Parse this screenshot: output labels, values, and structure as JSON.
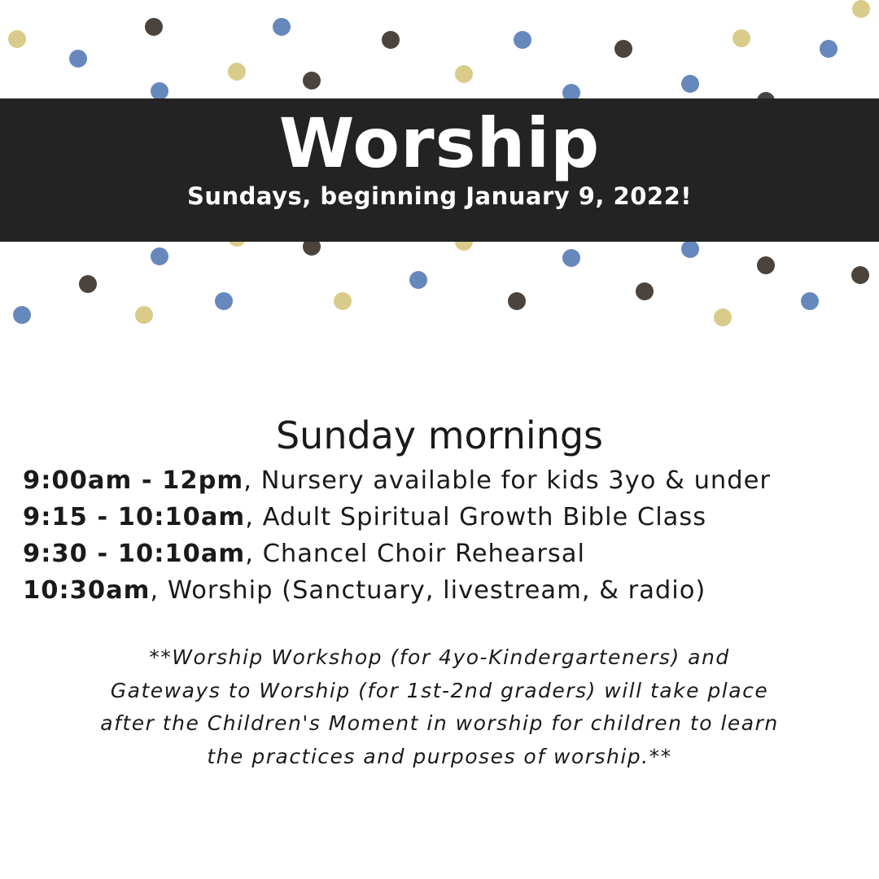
{
  "colors": {
    "banner_bg": "#232323",
    "dot_gold": "#d9cc8a",
    "dot_blue": "#6688bd",
    "dot_dark": "#4a433e"
  },
  "banner": {
    "title": "Worship",
    "subtitle": "Sundays, beginning January 9, 2022!"
  },
  "section": {
    "heading": "Sunday mornings"
  },
  "schedule": [
    {
      "time": "9:00am - 12pm",
      "description": ", Nursery available for kids 3yo & under"
    },
    {
      "time": "9:15 - 10:10am",
      "description": ", Adult Spiritual Growth Bible Class"
    },
    {
      "time": "9:30 - 10:10am",
      "description": ", Chancel Choir Rehearsal"
    },
    {
      "time": "10:30am",
      "description": ", Worship (Sanctuary, livestream, & radio)"
    }
  ],
  "note": [
    "**Worship Workshop (for 4yo-Kindergarteners) and",
    "Gateways to Worship (for 1st-2nd graders) will take place",
    "after the Children's Moment in worship for children to learn",
    "the practices and purposes of worship.**"
  ]
}
